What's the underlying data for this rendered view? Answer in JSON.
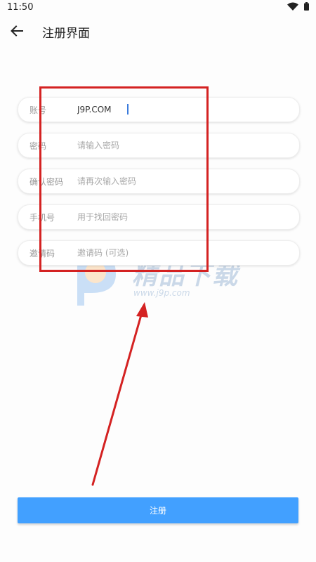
{
  "status_bar": {
    "time": "11:50",
    "icons": [
      "wifi-icon",
      "battery-icon"
    ]
  },
  "app_bar": {
    "title": "注册界面",
    "back_icon": "arrow-left-icon"
  },
  "form": {
    "fields": [
      {
        "label": "账号",
        "value": "J9P.COM",
        "placeholder": ""
      },
      {
        "label": "密码",
        "value": "",
        "placeholder": "请输入密码"
      },
      {
        "label": "确认密码",
        "value": "",
        "placeholder": "请再次输入密码"
      },
      {
        "label": "手机号",
        "value": "",
        "placeholder": "用于找回密码"
      },
      {
        "label": "邀请码",
        "value": "",
        "placeholder": "邀请码 (可选)"
      }
    ]
  },
  "watermark": {
    "brand": "精品下载",
    "url": "www.j9p.com"
  },
  "register_button": {
    "label": "注册"
  },
  "colors": {
    "accent": "#42a0ff",
    "highlight": "#d42222",
    "cursor": "#3b7bdc"
  }
}
